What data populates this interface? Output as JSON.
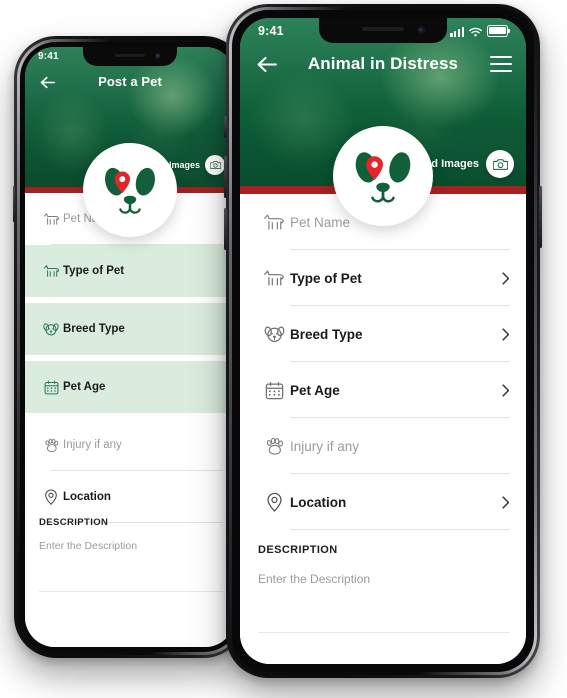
{
  "app": {
    "accent_green": "#0f6b3f",
    "dark_green": "#12603a",
    "highlight_green": "#d9ecdd",
    "red_bar": "#a8201f",
    "pin_red": "#e8242a",
    "placeholder_gray": "#9b9b9b"
  },
  "back_phone": {
    "status": {
      "time": "9:41"
    },
    "navbar": {
      "title": "Post a Pet",
      "back_icon": "arrow-left-icon"
    },
    "hero": {
      "upload_label": "Upload Images",
      "camera_icon": "camera-icon"
    },
    "logo": {
      "name": "dog-face-logo",
      "pin_icon": "location-pin-icon"
    },
    "fields": [
      {
        "label": "Pet Name",
        "icon": "dog-standing-icon",
        "style": "placeholder",
        "chevron": false,
        "highlight": false
      },
      {
        "label": "Type of Pet",
        "icon": "dog-standing-icon",
        "style": "value",
        "chevron": true,
        "highlight": true
      },
      {
        "label": "Breed Type",
        "icon": "dog-face-icon",
        "style": "value",
        "chevron": true,
        "highlight": true
      },
      {
        "label": "Pet Age",
        "icon": "calendar-icon",
        "style": "value",
        "chevron": true,
        "highlight": true
      },
      {
        "label": "Injury if any",
        "icon": "paw-icon",
        "style": "placeholder",
        "chevron": false,
        "highlight": false
      },
      {
        "label": "Location",
        "icon": "location-pin-icon",
        "style": "value",
        "chevron": true,
        "highlight": false
      }
    ],
    "description": {
      "heading": "DESCRIPTION",
      "placeholder": "Enter the Description"
    }
  },
  "front_phone": {
    "status": {
      "time": "9:41",
      "signal_icon": "signal-bars-icon",
      "wifi_icon": "wifi-icon",
      "battery_icon": "battery-icon"
    },
    "navbar": {
      "title": "Animal in Distress",
      "back_icon": "arrow-left-icon",
      "menu_icon": "hamburger-menu-icon"
    },
    "hero": {
      "upload_label": "Upload Images",
      "camera_icon": "camera-icon"
    },
    "logo": {
      "name": "dog-face-logo",
      "pin_icon": "location-pin-icon"
    },
    "fields": [
      {
        "label": "Pet Name",
        "icon": "dog-standing-icon",
        "style": "placeholder",
        "chevron": false
      },
      {
        "label": "Type of Pet",
        "icon": "dog-standing-icon",
        "style": "value",
        "chevron": true
      },
      {
        "label": "Breed Type",
        "icon": "dog-face-icon",
        "style": "value",
        "chevron": true
      },
      {
        "label": "Pet Age",
        "icon": "calendar-icon",
        "style": "value",
        "chevron": true
      },
      {
        "label": "Injury if any",
        "icon": "paw-icon",
        "style": "placeholder",
        "chevron": false
      },
      {
        "label": "Location",
        "icon": "location-pin-icon",
        "style": "value",
        "chevron": true
      }
    ],
    "description": {
      "heading": "DESCRIPTION",
      "placeholder": "Enter the Description"
    }
  }
}
